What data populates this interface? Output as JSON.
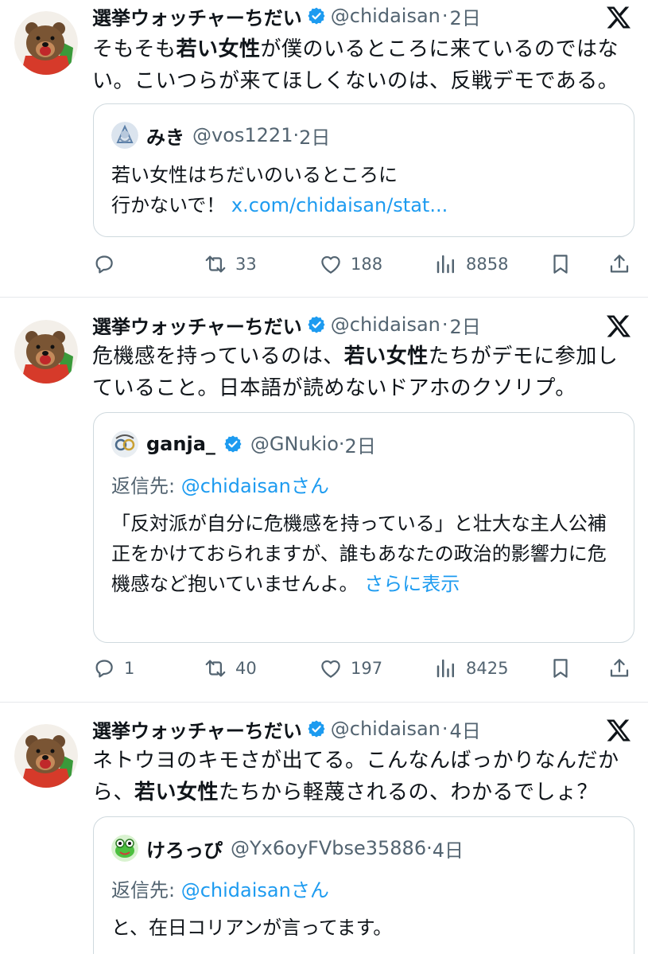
{
  "colors": {
    "text_primary": "#0f1419",
    "text_secondary": "#536471",
    "link": "#1d9bf0",
    "verified": "#1d9bf0",
    "border": "#cfd9de"
  },
  "tweets": [
    {
      "author_name": "選挙ウォッチャーちだい",
      "handle": "@chidaisan",
      "sep": "·",
      "time": "2日",
      "body": [
        {
          "t": "そもそも",
          "b": false
        },
        {
          "t": "若い女性",
          "b": true
        },
        {
          "t": "が僕のいるところに来ているのではない。こいつらが来てほしくないのは、反戦デモである。",
          "b": false
        }
      ],
      "quote": {
        "avatar_icon": "anime-character-avatar-icon",
        "name": "みき",
        "handle": "@vos1221",
        "sep": "·",
        "time": "2日",
        "text_line1": "若い女性はちだいのいるところに",
        "text_line2": "行かないで！",
        "link": "x.com/chidaisan/stat..."
      },
      "actions": {
        "reply": "",
        "retweet": "33",
        "like": "188",
        "views": "8858"
      }
    },
    {
      "author_name": "選挙ウォッチャーちだい",
      "handle": "@chidaisan",
      "sep": "·",
      "time": "2日",
      "body": [
        {
          "t": "危機感を持っているのは、",
          "b": false
        },
        {
          "t": "若い女性",
          "b": true
        },
        {
          "t": "たちがデモに参加していること。日本語が読めないドアホのクソリプ。",
          "b": false
        }
      ],
      "quote": {
        "avatar_icon": "spiral-logo-avatar-icon",
        "name": "ganja_",
        "verified": true,
        "handle": "@GNukio",
        "sep": "·",
        "time": "2日",
        "reply_prefix": "返信先: ",
        "reply_handle": "@chidaisan",
        "reply_suffix": "さん",
        "text": "「反対派が自分に危機感を持っている」と壮大な主人公補正をかけておられますが、誰もあなたの政治的影響力に危機感など抱いていませんよ。",
        "more": "さらに表示"
      },
      "actions": {
        "reply": "1",
        "retweet": "40",
        "like": "197",
        "views": "8425"
      }
    },
    {
      "author_name": "選挙ウォッチャーちだい",
      "handle": "@chidaisan",
      "sep": "·",
      "time": "4日",
      "body": [
        {
          "t": "ネトウヨのキモさが出てる。こんなんばっかりなんだから、",
          "b": false
        },
        {
          "t": "若い女性",
          "b": true
        },
        {
          "t": "たちから軽蔑されるの、わかるでしょ？",
          "b": false
        }
      ],
      "quote": {
        "avatar_icon": "frog-character-avatar-icon",
        "name": "けろっぴ",
        "handle": "@Yx6oyFVbse35886",
        "sep": "·",
        "time": "4日",
        "reply_prefix": "返信先: ",
        "reply_handle": "@chidaisan",
        "reply_suffix": "さん",
        "text": "と、在日コリアンが言ってます。"
      }
    }
  ]
}
